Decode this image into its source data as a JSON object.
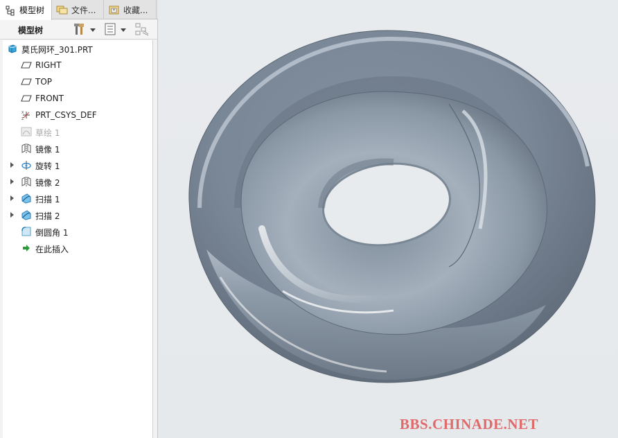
{
  "tabs": [
    {
      "label": "模型树",
      "icon": "model-tree-icon"
    },
    {
      "label": "文件...",
      "icon": "folder-browser-icon"
    },
    {
      "label": "收藏...",
      "icon": "favorites-icon"
    }
  ],
  "toolbar": {
    "title": "模型树",
    "settings_icon": "settings-tools-icon",
    "show_icon": "show-list-icon",
    "filter_icon": "tree-filter-icon"
  },
  "tree": {
    "root": {
      "label": "莫氏网环_301.PRT",
      "icon": "part-icon"
    },
    "items": [
      {
        "label": "RIGHT",
        "icon": "datum-plane-icon",
        "expandable": false
      },
      {
        "label": "TOP",
        "icon": "datum-plane-icon",
        "expandable": false
      },
      {
        "label": "FRONT",
        "icon": "datum-plane-icon",
        "expandable": false
      },
      {
        "label": "PRT_CSYS_DEF",
        "icon": "coordinate-system-icon",
        "expandable": false
      },
      {
        "label": "草绘 1",
        "icon": "sketch-icon",
        "expandable": false,
        "muted": true
      },
      {
        "label": "镜像 1",
        "icon": "mirror-icon",
        "expandable": false
      },
      {
        "label": "旋转 1",
        "icon": "revolve-icon",
        "expandable": true
      },
      {
        "label": "镜像 2",
        "icon": "mirror-icon",
        "expandable": true
      },
      {
        "label": "扫描 1",
        "icon": "sweep-icon",
        "expandable": true
      },
      {
        "label": "扫描 2",
        "icon": "sweep-icon",
        "expandable": true
      },
      {
        "label": "倒圆角 1",
        "icon": "round-icon",
        "expandable": false
      },
      {
        "label": "在此插入",
        "icon": "insert-here-arrow-icon",
        "expandable": false
      }
    ]
  },
  "viewport": {
    "background": "#e8ebee",
    "model_color": "#8e9aa8",
    "model": "moebius-torus-3d-model"
  },
  "watermark": "BBS.CHINADE.NET"
}
